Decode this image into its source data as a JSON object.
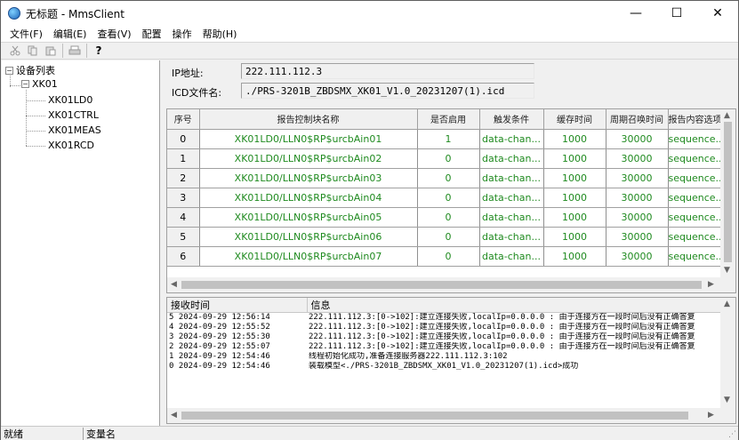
{
  "window": {
    "title": "无标题 - MmsClient",
    "minimize": "—",
    "maximize": "☐",
    "close": "✕"
  },
  "menu": [
    "文件(F)",
    "编辑(E)",
    "查看(V)",
    "配置",
    "操作",
    "帮助(H)"
  ],
  "toolbar": {
    "cut": "cut-icon",
    "copy": "copy-icon",
    "paste": "paste-icon",
    "print": "print-icon",
    "help": "?"
  },
  "tree": {
    "root": "设备列表",
    "device": "XK01",
    "children": [
      "XK01LD0",
      "XK01CTRL",
      "XK01MEAS",
      "XK01RCD"
    ]
  },
  "info": {
    "ip_label": "IP地址:",
    "ip_value": "222.111.112.3",
    "icd_label": "ICD文件名:",
    "icd_value": "./PRS-3201B_ZBDSMX_XK01_V1.0_20231207(1).icd"
  },
  "grid": {
    "headers": [
      "序号",
      "报告控制块名称",
      "是否启用",
      "触发条件",
      "缓存时间",
      "周期召唤时间",
      "报告内容选项"
    ],
    "rows": [
      [
        "0",
        "XK01LD0/LLN0$RP$urcbAin01",
        "1",
        "data-chan...",
        "1000",
        "30000",
        "sequence..."
      ],
      [
        "1",
        "XK01LD0/LLN0$RP$urcbAin02",
        "0",
        "data-chan...",
        "1000",
        "30000",
        "sequence..."
      ],
      [
        "2",
        "XK01LD0/LLN0$RP$urcbAin03",
        "0",
        "data-chan...",
        "1000",
        "30000",
        "sequence..."
      ],
      [
        "3",
        "XK01LD0/LLN0$RP$urcbAin04",
        "0",
        "data-chan...",
        "1000",
        "30000",
        "sequence..."
      ],
      [
        "4",
        "XK01LD0/LLN0$RP$urcbAin05",
        "0",
        "data-chan...",
        "1000",
        "30000",
        "sequence..."
      ],
      [
        "5",
        "XK01LD0/LLN0$RP$urcbAin06",
        "0",
        "data-chan...",
        "1000",
        "30000",
        "sequence..."
      ],
      [
        "6",
        "XK01LD0/LLN0$RP$urcbAin07",
        "0",
        "data-chan...",
        "1000",
        "30000",
        "sequence..."
      ]
    ]
  },
  "log": {
    "headers": [
      "接收时间",
      "信息"
    ],
    "rows": [
      [
        "5 2024-09-29 12:56:14",
        "222.111.112.3:[0->102]:建立连接失败,localIp=0.0.0.0 : 由于连接方在一段时间后没有正确答复"
      ],
      [
        "4 2024-09-29 12:55:52",
        "222.111.112.3:[0->102]:建立连接失败,localIp=0.0.0.0 : 由于连接方在一段时间后没有正确答复"
      ],
      [
        "3 2024-09-29 12:55:30",
        "222.111.112.3:[0->102]:建立连接失败,localIp=0.0.0.0 : 由于连接方在一段时间后没有正确答复"
      ],
      [
        "2 2024-09-29 12:55:07",
        "222.111.112.3:[0->102]:建立连接失败,localIp=0.0.0.0 : 由于连接方在一段时间后没有正确答复"
      ],
      [
        "1 2024-09-29 12:54:46",
        "线程初始化成功,准备连接服务器222.111.112.3:102"
      ],
      [
        "0 2024-09-29 12:54:46",
        "装载模型<./PRS-3201B_ZBDSMX_XK01_V1.0_20231207(1).icd>成功"
      ]
    ]
  },
  "status": {
    "ready": "就绪",
    "var": "变量名"
  }
}
